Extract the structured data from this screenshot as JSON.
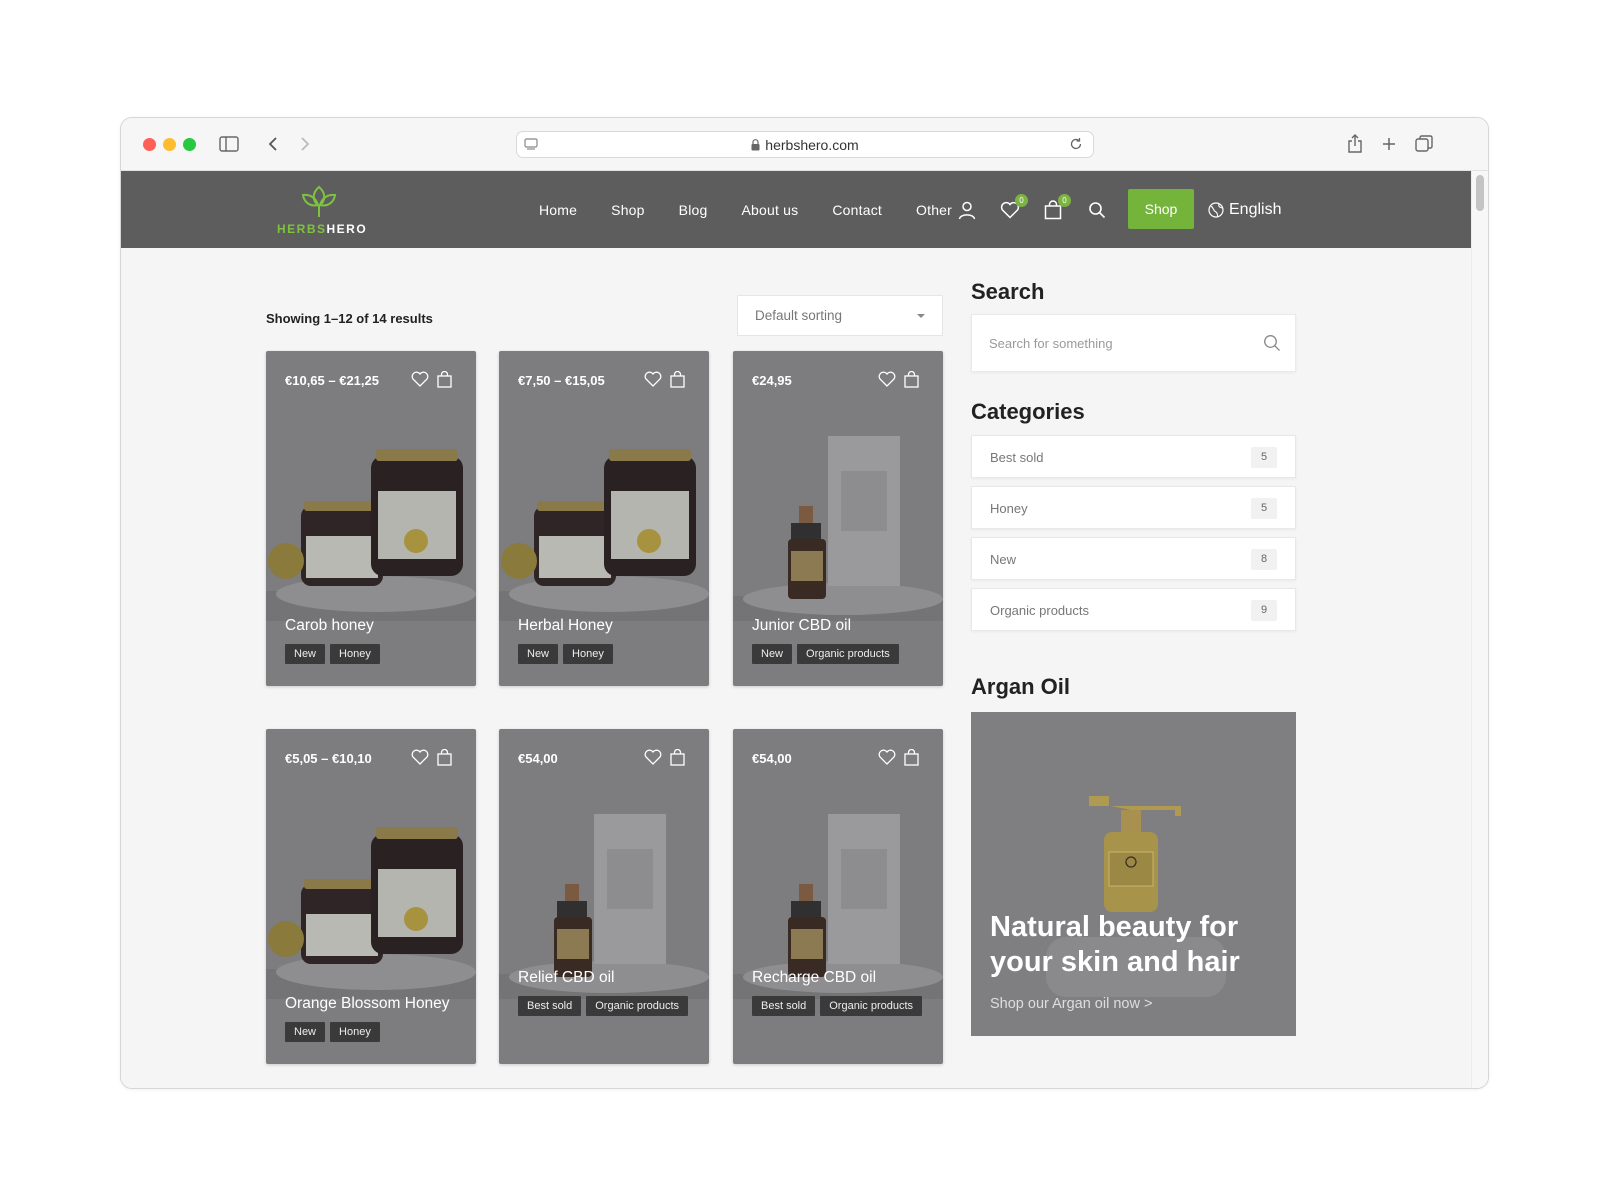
{
  "browser": {
    "url": "herbshero.com"
  },
  "header": {
    "logo_left": "HERBS",
    "logo_right": "HERO",
    "nav": [
      "Home",
      "Shop",
      "Blog",
      "About us",
      "Contact",
      "Other"
    ],
    "wishlist_count": "0",
    "cart_count": "0",
    "shop_button": "Shop",
    "language": "English",
    "colors": {
      "header_bg": "#5d5d5d",
      "accent": "#74b43b"
    }
  },
  "listing": {
    "results_text": "Showing 1–12 of 14 results",
    "sorting": "Default sorting"
  },
  "products": [
    {
      "price": "€10,65 – €21,25",
      "name": "Carob honey",
      "tags": [
        "New",
        "Honey"
      ],
      "kind": "honey"
    },
    {
      "price": "€7,50 – €15,05",
      "name": "Herbal Honey",
      "tags": [
        "New",
        "Honey"
      ],
      "kind": "honey"
    },
    {
      "price": "€24,95",
      "name": "Junior CBD oil",
      "tags": [
        "New",
        "Organic products"
      ],
      "kind": "oil"
    },
    {
      "price": "€5,05 – €10,10",
      "name": "Orange Blossom Honey",
      "tags": [
        "New",
        "Honey"
      ],
      "kind": "honey"
    },
    {
      "price": "€54,00",
      "name": "Relief CBD oil",
      "tags": [
        "Best sold",
        "Organic products"
      ],
      "kind": "oil"
    },
    {
      "price": "€54,00",
      "name": "Recharge CBD oil",
      "tags": [
        "Best sold",
        "Organic products"
      ],
      "kind": "oil"
    }
  ],
  "sidebar": {
    "search_title": "Search",
    "search_placeholder": "Search for something",
    "categories_title": "Categories",
    "categories": [
      {
        "label": "Best sold",
        "count": "5"
      },
      {
        "label": "Honey",
        "count": "5"
      },
      {
        "label": "New",
        "count": "8"
      },
      {
        "label": "Organic products",
        "count": "9"
      }
    ],
    "promo_title": "Argan Oil",
    "promo_heading": "Natural beauty for your skin and hair",
    "promo_link": "Shop our Argan oil now  >"
  }
}
